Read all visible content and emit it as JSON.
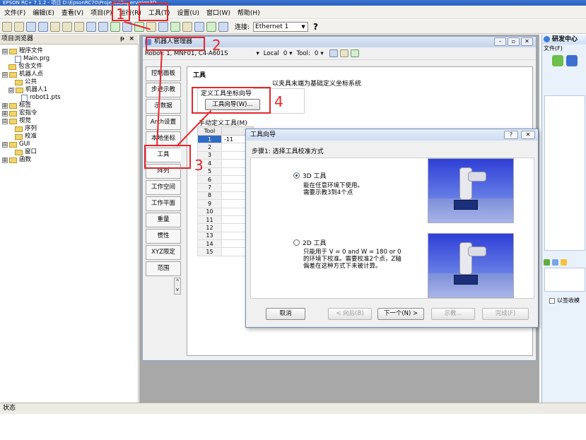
{
  "app": {
    "title": "EPSON RC+ 7.1.2 - 项目 D:\\EpsonRC70\\Projects\\Supervision3D"
  },
  "menu": [
    "文件(F)",
    "编辑(E)",
    "查看(V)",
    "项目(P)",
    "运行(R)",
    "工具(T)",
    "设置(U)",
    "窗口(W)",
    "帮助(H)"
  ],
  "toolbar": {
    "connection_label": "连接:",
    "connection_value": "Ethernet 1",
    "help": "?"
  },
  "project_explorer": {
    "title": "项目浏览器",
    "pin": "ᵽ",
    "close": "×",
    "tree": [
      {
        "label": "程序文件",
        "level": 0,
        "kind": "folder",
        "expand": "⊟"
      },
      {
        "label": "Main.prg",
        "level": 2,
        "kind": "file",
        "expand": ""
      },
      {
        "label": "包含文件",
        "level": 1,
        "kind": "folder",
        "expand": ""
      },
      {
        "label": "机器人点",
        "level": 0,
        "kind": "folder",
        "expand": "⊟"
      },
      {
        "label": "公共",
        "level": 2,
        "kind": "folder",
        "expand": ""
      },
      {
        "label": "机器人1",
        "level": 1,
        "kind": "folder",
        "expand": "⊟"
      },
      {
        "label": "robot1.pts",
        "level": 3,
        "kind": "file",
        "expand": ""
      },
      {
        "label": "标签",
        "level": 0,
        "kind": "folder",
        "expand": "⊞"
      },
      {
        "label": "宏指令",
        "level": 0,
        "kind": "folder",
        "expand": "⊞"
      },
      {
        "label": "视觉",
        "level": 0,
        "kind": "folder",
        "expand": "⊟"
      },
      {
        "label": "序列",
        "level": 2,
        "kind": "folder",
        "expand": ""
      },
      {
        "label": "校准",
        "level": 2,
        "kind": "folder",
        "expand": ""
      },
      {
        "label": "GUI",
        "level": 0,
        "kind": "folder",
        "expand": "⊟"
      },
      {
        "label": "窗口",
        "level": 2,
        "kind": "folder",
        "expand": ""
      },
      {
        "label": "函数",
        "level": 0,
        "kind": "folder",
        "expand": "⊞"
      }
    ]
  },
  "robot_manager": {
    "title": "机器人管理器",
    "robot_label": "Robot: 1, MNF01, C4-A601S",
    "local_label": "Local",
    "local_value": "0",
    "tool_label": "Tool:",
    "tool_value": "0",
    "tabs": [
      "控制面板",
      "步进示教",
      "示数据",
      "Arch设置",
      "本地坐标",
      "工具",
      "阵列",
      "工作空间",
      "工作平面",
      "重量",
      "惯性",
      "XYZ限定",
      "范围"
    ],
    "active_tab": "工具",
    "panel_title": "工具",
    "panel_desc": "以夹具末端为基础定义坐标系统",
    "group_label": "定义工具坐标向导",
    "wizard_button": "工具向导(W)...",
    "manual_label": "手动定义工具(M)",
    "table_header": "Tool",
    "rows": [
      "1",
      "2",
      "3",
      "4",
      "5",
      "6",
      "7",
      "8",
      "9",
      "10",
      "11",
      "12",
      "13",
      "14",
      "15"
    ],
    "first_value": "-11"
  },
  "wizard": {
    "title": "工具向导",
    "help": "?",
    "close": "✕",
    "step": "步骤1: 选择工具校准方式",
    "option_3d": "3D 工具",
    "desc_3d": [
      "能在任意环境下使用。",
      "需要示教3到4个点"
    ],
    "option_2d": "2D 工具",
    "desc_2d": [
      "只能用于 V = 0 and W = 180 or 0",
      "的环境下校准。需要校准2个点，Z轴",
      "偏差在这种方式下未被计算。"
    ],
    "buttons": {
      "cancel": "取消",
      "back": "< 向后(B)",
      "next": "下一个(N) >",
      "teach": "示教...",
      "finish": "完成(F)"
    }
  },
  "right_panel": {
    "title": "研发中心",
    "menu": "文件(F)",
    "checkbox_label": "以签收模"
  },
  "status": {
    "text": "状态"
  },
  "annotations": [
    "1",
    "2",
    "3",
    "4"
  ],
  "colors": {
    "highlight": "#e3262b",
    "accent": "#316ac5"
  }
}
